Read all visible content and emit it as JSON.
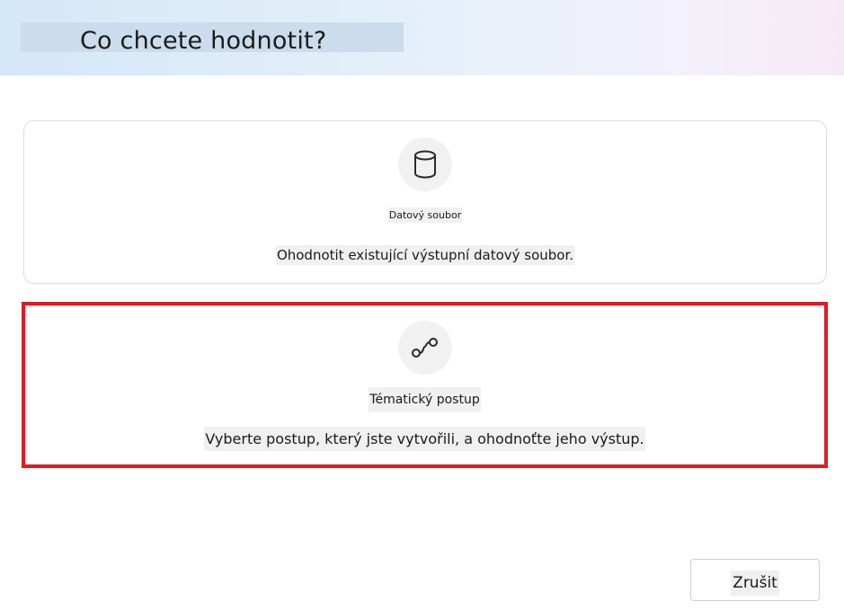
{
  "dialog": {
    "title": "Co chcete hodnotit?"
  },
  "options": [
    {
      "icon": "database-icon",
      "title": "Datový soubor",
      "description": "Ohodnotit existující výstupní datový soubor.",
      "selected": false
    },
    {
      "icon": "flow-icon",
      "title": "Tématický postup",
      "description": "Vyberte postup, který jste vytvořili, a ohodnoťte jeho výstup.",
      "selected": true
    }
  ],
  "footer": {
    "cancel_label": "Zrušit"
  },
  "colors": {
    "selection_outline": "#e01b24",
    "header_gradient_start": "#d4e7f7",
    "header_gradient_end": "#f6e9f6"
  }
}
